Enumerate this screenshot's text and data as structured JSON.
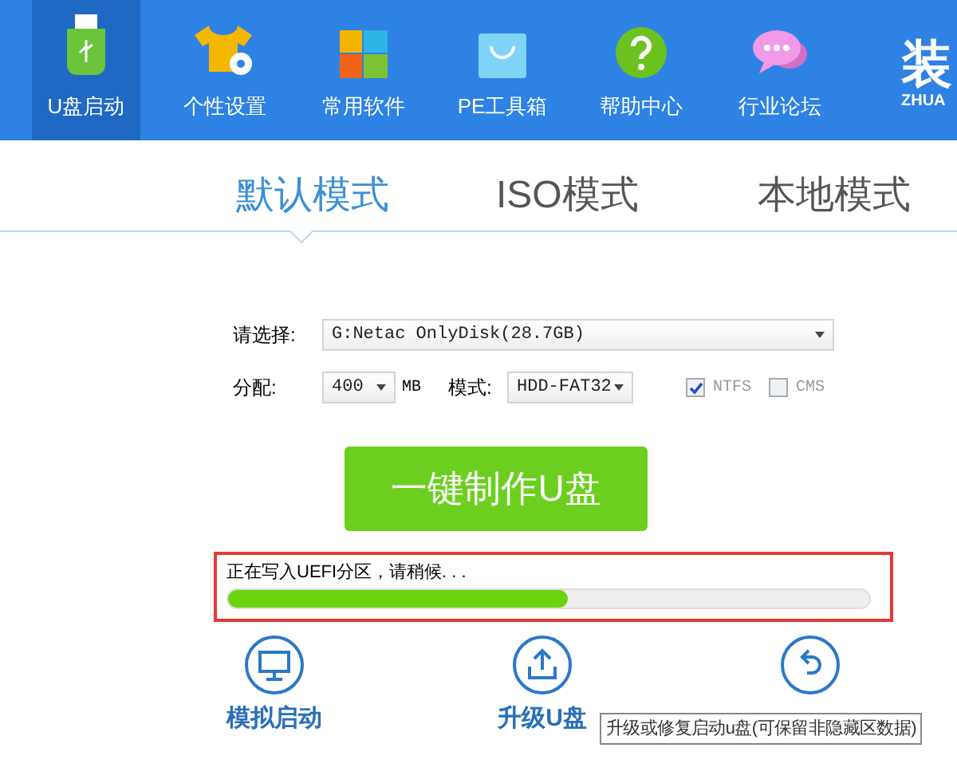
{
  "nav": [
    {
      "label": "U盘启动",
      "selected": true
    },
    {
      "label": "个性设置",
      "selected": false
    },
    {
      "label": "常用软件",
      "selected": false
    },
    {
      "label": "PE工具箱",
      "selected": false
    },
    {
      "label": "帮助中心",
      "selected": false
    },
    {
      "label": "行业论坛",
      "selected": false
    }
  ],
  "logo": {
    "text": "装",
    "subtext": "ZHUA"
  },
  "tabs": [
    {
      "label": "默认模式",
      "selected": true
    },
    {
      "label": "ISO模式",
      "selected": false
    },
    {
      "label": "本地模式",
      "selected": false
    }
  ],
  "form": {
    "disk_label": "请选择:",
    "disk_value": "G:Netac OnlyDisk(28.7GB)",
    "alloc_label": "分配:",
    "alloc_value": "400",
    "alloc_unit": "MB",
    "mode_label": "模式:",
    "mode_value": "HDD-FAT32",
    "options": [
      {
        "label": "NTFS",
        "checked": true,
        "disabled": true
      },
      {
        "label": "CMS",
        "checked": false,
        "disabled": true
      }
    ]
  },
  "make_button": "一键制作U盘",
  "progress": {
    "message": "正在写入UEFI分区，请稍候. . .",
    "level": 0.53
  },
  "actions": [
    {
      "label": "模拟启动",
      "kind": "monitor"
    },
    {
      "label": "升级U盘",
      "kind": "upload"
    },
    {
      "kind": "restore"
    }
  ],
  "tooltip": "升级或修复启动u盘(可保留非隐藏区数据)"
}
